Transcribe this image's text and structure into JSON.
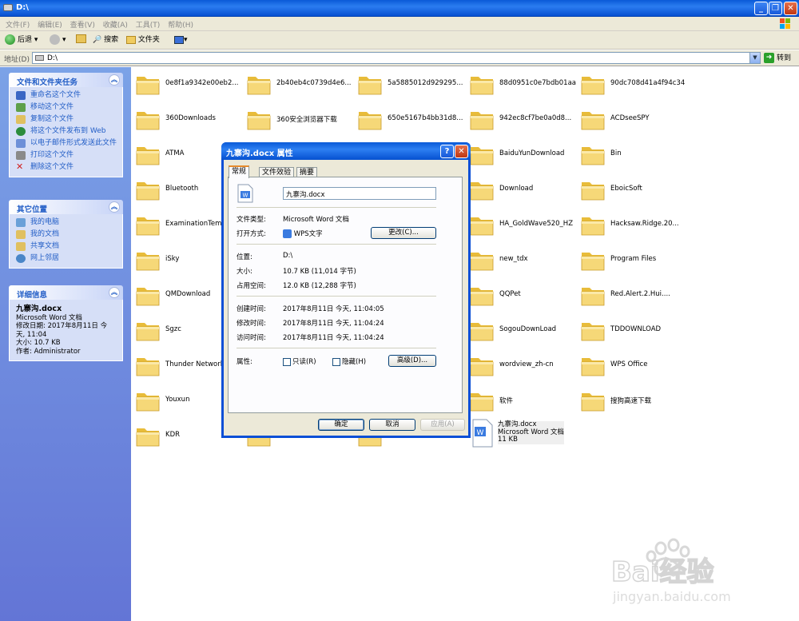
{
  "window": {
    "title": "D:\\"
  },
  "menu": [
    "文件(F)",
    "编辑(E)",
    "查看(V)",
    "收藏(A)",
    "工具(T)",
    "帮助(H)"
  ],
  "toolbar": {
    "back": "后退",
    "search": "搜索",
    "folders": "文件夹"
  },
  "address": {
    "label": "地址(D)",
    "value": "D:\\",
    "go": "转到"
  },
  "tasks": {
    "title": "文件和文件夹任务",
    "items": [
      "重命名这个文件",
      "移动这个文件",
      "复制这个文件",
      "将这个文件发布到 Web",
      "以电子邮件形式发送此文件",
      "打印这个文件",
      "删除这个文件"
    ]
  },
  "places": {
    "title": "其它位置",
    "items": [
      "我的电脑",
      "我的文档",
      "共享文档",
      "网上邻居"
    ]
  },
  "details": {
    "title": "详细信息",
    "name": "九寨沟.docx",
    "type": "Microsoft Word 文档",
    "modified": "修改日期: 2017年8月11日 今天, 11:04",
    "size": "大小: 10.7 KB",
    "author": "作者: Administrator"
  },
  "files": [
    [
      "0e8f1a9342e00eb2...",
      "2b40eb4c0739d4e6...",
      "5a5885012d929295...",
      "88d0951c0e7bdb01aa",
      "90dc708d41a4f94c34"
    ],
    [
      "360Downloads",
      "360安全浏览器下载",
      "650e5167b4bb31d8...",
      "942ec8cf7be0a0d8...",
      "ACDseeSPY"
    ],
    [
      "ATMA",
      "",
      "",
      "BaiduYunDownload",
      "Bin"
    ],
    [
      "Bluetooth",
      "",
      "",
      "Download",
      "EboicSoft"
    ],
    [
      "ExaminationTemp",
      "",
      "",
      "HA_GoldWave520_HZ",
      "Hacksaw.Ridge.20..."
    ],
    [
      "iSky",
      "",
      "",
      "new_tdx",
      "Program Files"
    ],
    [
      "QMDownload",
      "",
      "",
      "QQPet",
      "Red.Alert.2.Hui...."
    ],
    [
      "Sgzc",
      "",
      "",
      "SogouDownLoad",
      "TDDOWNLOAD"
    ],
    [
      "Thunder Network",
      "",
      "",
      "wordview_zh-cn",
      "WPS Office"
    ],
    [
      "Youxun",
      "",
      "",
      "软件",
      "搜狗高速下载"
    ],
    [
      "KDR",
      "",
      "",
      "",
      ""
    ]
  ],
  "selected_file": {
    "name": "九寨沟.docx",
    "type": "Microsoft Word 文档",
    "size": "11 KB"
  },
  "dialog": {
    "title": "九寨沟.docx 属性",
    "tabs": [
      "常规",
      "文件效验",
      "摘要"
    ],
    "filename": "九寨沟.docx",
    "type_label": "文件类型:",
    "type_value": "Microsoft Word 文档",
    "open_label": "打开方式:",
    "open_value": "WPS文字",
    "change_btn": "更改(C)...",
    "location_label": "位置:",
    "location_value": "D:\\",
    "size_label": "大小:",
    "size_value": "10.7 KB (11,014 字节)",
    "disk_label": "占用空间:",
    "disk_value": "12.0 KB (12,288 字节)",
    "created_label": "创建时间:",
    "created_value": "2017年8月11日 今天, 11:04:05",
    "modified_label": "修改时间:",
    "modified_value": "2017年8月11日 今天, 11:04:24",
    "accessed_label": "访问时间:",
    "accessed_value": "2017年8月11日 今天, 11:04:24",
    "attr_label": "属性:",
    "readonly": "只读(R)",
    "hidden": "隐藏(H)",
    "advanced_btn": "高级(D)...",
    "ok": "确定",
    "cancel": "取消",
    "apply": "应用(A)"
  },
  "watermark": {
    "text": "Bai经验",
    "sub": "jingyan.baidu.com"
  }
}
